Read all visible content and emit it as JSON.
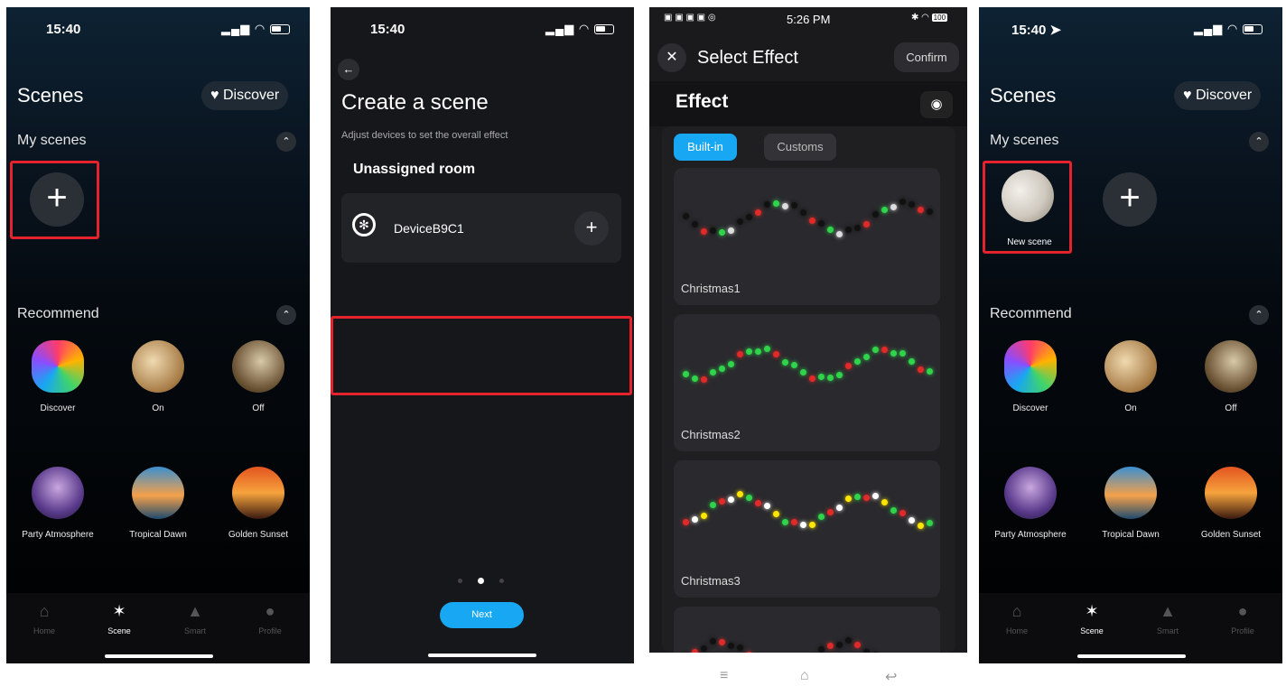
{
  "panel1": {
    "time": "15:40",
    "title": "Scenes",
    "discover_label": "Discover",
    "my_scenes": "My scenes",
    "recommend": "Recommend",
    "recommended": [
      {
        "label": "Discover"
      },
      {
        "label": "On"
      },
      {
        "label": "Off"
      },
      {
        "label": "Party Atmosphere"
      },
      {
        "label": "Tropical Dawn"
      },
      {
        "label": "Golden Sunset"
      }
    ],
    "tabs": [
      {
        "label": "Home"
      },
      {
        "label": "Scene"
      },
      {
        "label": "Smart"
      },
      {
        "label": "Profile"
      }
    ]
  },
  "panel2": {
    "time": "15:40",
    "title": "Create a scene",
    "subtitle": "Adjust devices to set the overall effect",
    "room": "Unassigned room",
    "device_name": "DeviceB9C1",
    "next_label": "Next"
  },
  "panel3": {
    "time": "5:26 PM",
    "battery": "100",
    "title": "Select Effect",
    "confirm_label": "Confirm",
    "effect_heading": "Effect",
    "tabs": [
      {
        "label": "Built-in"
      },
      {
        "label": "Customs"
      }
    ],
    "effects": [
      {
        "name": "Christmas1"
      },
      {
        "name": "Christmas2"
      },
      {
        "name": "Christmas3"
      }
    ]
  },
  "panel4": {
    "time": "15:40",
    "title": "Scenes",
    "discover_label": "Discover",
    "my_scenes": "My scenes",
    "new_scene_label": "New scene",
    "recommend": "Recommend",
    "recommended": [
      {
        "label": "Discover"
      },
      {
        "label": "On"
      },
      {
        "label": "Off"
      },
      {
        "label": "Party Atmosphere"
      },
      {
        "label": "Tropical Dawn"
      },
      {
        "label": "Golden Sunset"
      }
    ],
    "tabs": [
      {
        "label": "Home"
      },
      {
        "label": "Scene"
      },
      {
        "label": "Smart"
      },
      {
        "label": "Profile"
      }
    ]
  },
  "colors": {
    "accent_blue": "#18a7f2",
    "highlight_red": "#e5232c"
  }
}
